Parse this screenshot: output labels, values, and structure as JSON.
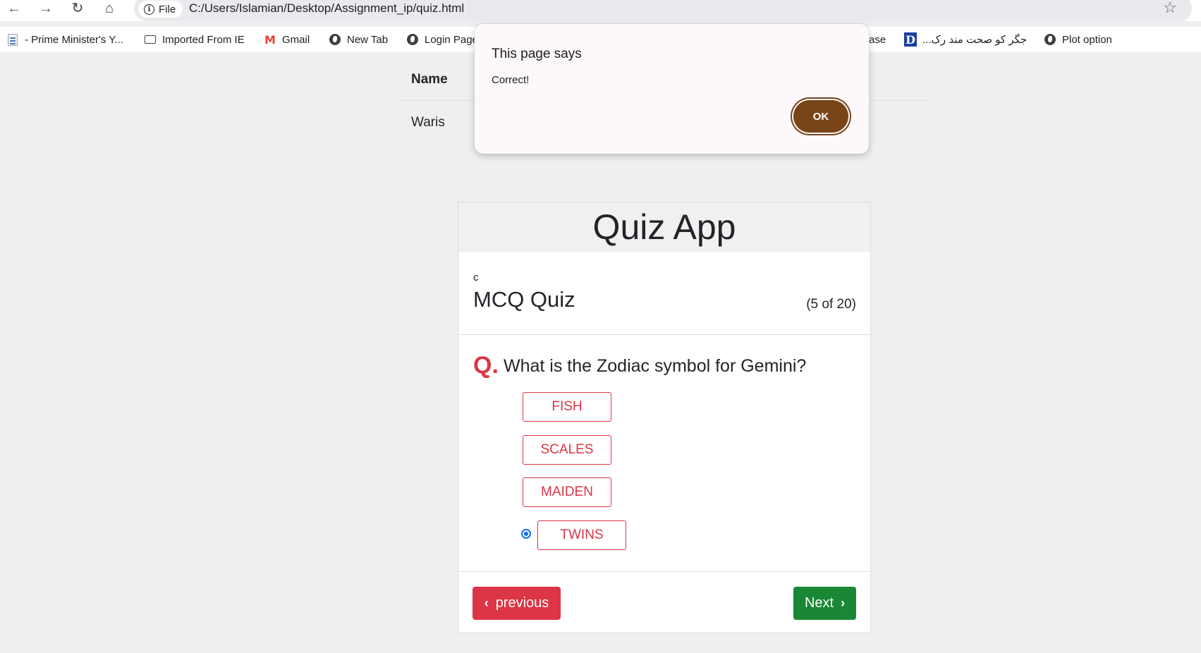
{
  "browser": {
    "back_icon": "arrow-left-icon",
    "forward_icon": "arrow-right-icon",
    "site_chip": "File",
    "url": "C:/Users/Islamian/Desktop/Assignment_ip/quiz.html"
  },
  "bookmarks": [
    {
      "label": "- Prime Minister's Y...",
      "icon": "document-icon"
    },
    {
      "label": "Imported From IE",
      "icon": "folder-icon"
    },
    {
      "label": "Gmail",
      "icon": "gmail-icon"
    },
    {
      "label": "New Tab",
      "icon": "globe-icon"
    },
    {
      "label": "Login Page",
      "icon": "globe-icon"
    },
    {
      "label": "ase",
      "icon": ""
    },
    {
      "label": "جگر کو صحت مند رک...",
      "icon": "d-logo-icon"
    },
    {
      "label": "Plot option",
      "icon": "globe-icon"
    }
  ],
  "table": {
    "header": "Name",
    "rows": [
      "Waris"
    ]
  },
  "quiz": {
    "app_title": "Quiz App",
    "small_label": "c",
    "title": "MCQ Quiz",
    "progress": "(5 of 20)",
    "question_marker": "Q.",
    "question": "What is the Zodiac symbol for Gemini?",
    "options": [
      "FISH",
      "SCALES",
      "MAIDEN",
      "TWINS"
    ],
    "selected_option": "TWINS",
    "previous_label": "previous",
    "next_label": "Next"
  },
  "dialog": {
    "title": "This page says",
    "message": "Correct!",
    "ok_label": "OK"
  },
  "colors": {
    "danger": "#dc3545",
    "success": "#198734",
    "dialog_button": "#7a4419"
  }
}
